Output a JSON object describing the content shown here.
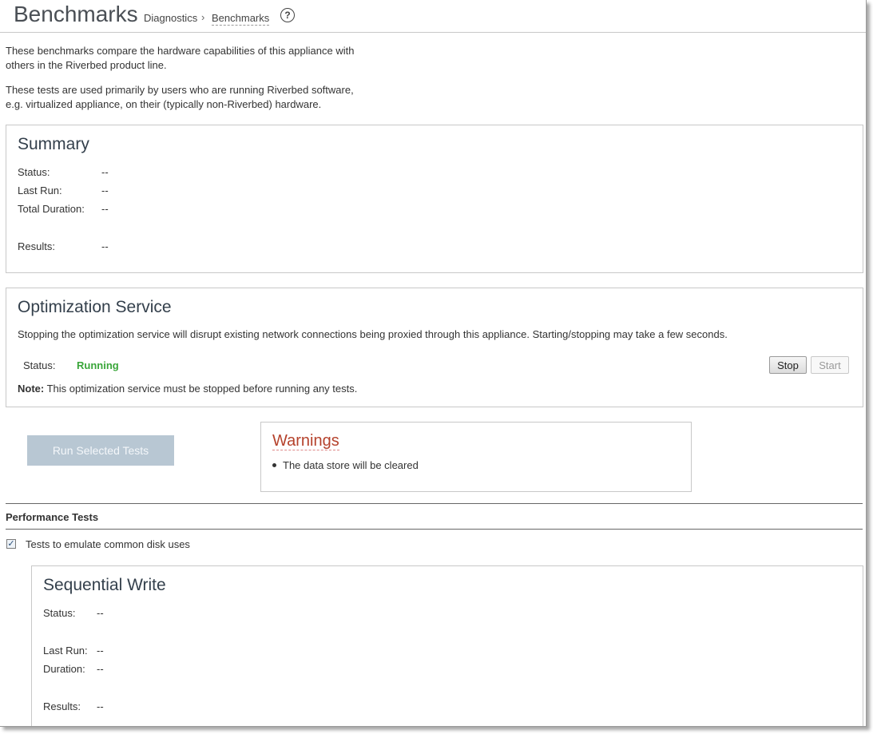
{
  "header": {
    "title": "Benchmarks",
    "breadcrumb": {
      "parent": "Diagnostics",
      "separator": "›",
      "current": "Benchmarks"
    },
    "help_icon": "?"
  },
  "intro": {
    "line1": "These benchmarks compare the hardware capabilities of this appliance with",
    "line2": "others in the Riverbed product line.",
    "line3": "These tests are used primarily by users who are running Riverbed software,",
    "line4": "e.g. virtualized appliance, on their (typically non-Riverbed) hardware."
  },
  "summary": {
    "title": "Summary",
    "status_label": "Status:",
    "status_value": "--",
    "last_run_label": "Last Run:",
    "last_run_value": "--",
    "duration_label": "Total Duration:",
    "duration_value": "--",
    "results_label": "Results:",
    "results_value": "--"
  },
  "optimization": {
    "title": "Optimization Service",
    "description": "Stopping the optimization service will disrupt existing network connections being proxied through this appliance. Starting/stopping may take a few seconds.",
    "status_label": "Status:",
    "status_value": "Running",
    "status_color": "#3aa63a",
    "stop_label": "Stop",
    "start_label": "Start",
    "note_bold": "Note:",
    "note_text": " This optimization service must be stopped before running any tests."
  },
  "actions": {
    "run_label": "Run Selected Tests"
  },
  "warnings": {
    "title": "Warnings",
    "items": [
      "The data store will be cleared"
    ]
  },
  "performance": {
    "section_label": "Performance Tests",
    "checkbox_checked": true,
    "checkbox_label": "Tests to emulate common disk uses"
  },
  "sequential_write": {
    "title": "Sequential Write",
    "status_label": "Status:",
    "status_value": "--",
    "last_run_label": "Last Run:",
    "last_run_value": "--",
    "duration_label": "Duration:",
    "duration_value": "--",
    "results_label": "Results:",
    "results_value": "--"
  }
}
